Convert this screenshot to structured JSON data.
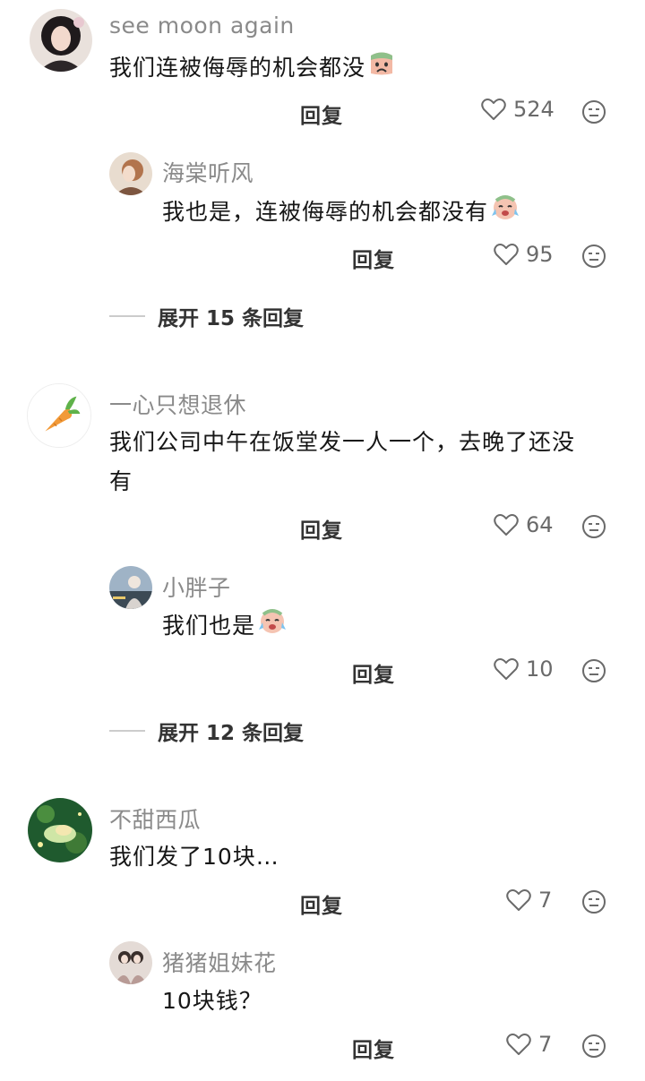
{
  "ui": {
    "reply_label": "回复",
    "colors": {
      "text": "#161616",
      "username": "#8a8a8a",
      "meta": "#6a6a6a",
      "divider": "#cccccc",
      "background": "#ffffff"
    }
  },
  "threads": [
    {
      "comment": {
        "username": "see moon again",
        "text": "我们连被侮辱的机会都没",
        "emoji": "sad-face-emoji",
        "likes": "524"
      },
      "reply": {
        "username": "海棠听风",
        "text": "我也是，连被侮辱的机会都没有",
        "emoji": "crying-face-emoji",
        "likes": "95"
      },
      "expand_label": "展开 15 条回复"
    },
    {
      "comment": {
        "username": "一心只想退休",
        "text_line1": "我们公司中午在饭堂发一人一个，去晚了还没",
        "text_line2": "有",
        "likes": "64"
      },
      "reply": {
        "username": "小胖子",
        "text": "我们也是",
        "emoji": "crying-face-emoji",
        "likes": "10"
      },
      "expand_label": "展开 12 条回复"
    },
    {
      "comment": {
        "username": "不甜西瓜",
        "text": "我们发了10块…",
        "likes": "7"
      },
      "reply": {
        "username": "猪猪姐妹花",
        "text": "10块钱？",
        "likes": "7"
      }
    }
  ]
}
